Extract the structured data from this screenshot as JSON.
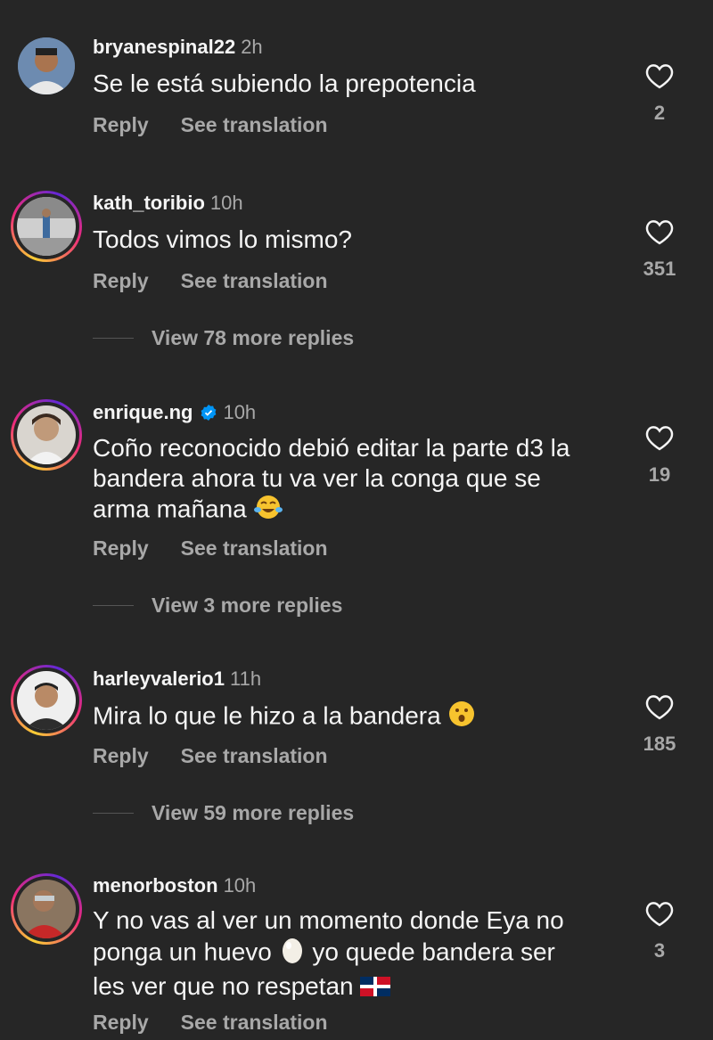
{
  "comments": [
    {
      "username": "bryanespinal22",
      "time": "2h",
      "text": "Se le está subiendo la prepotencia",
      "reply": "Reply",
      "translate": "See translation",
      "likes": "2"
    },
    {
      "username": "kath_toribio",
      "time": "10h",
      "text": "Todos vimos lo mismo?",
      "reply": "Reply",
      "translate": "See translation",
      "likes": "351",
      "more": "View 78 more replies"
    },
    {
      "username": "enrique.ng",
      "time": "10h",
      "text_lines": [
        "Coño reconocido debió editar la parte d3 la",
        "bandera ahora tu va ver la conga que se",
        "arma mañana"
      ],
      "reply": "Reply",
      "translate": "See translation",
      "likes": "19",
      "more": "View 3 more replies",
      "verified": true
    },
    {
      "username": "harleyvalerio1",
      "time": "11h",
      "text": "Mira lo que le hizo a la bandera",
      "reply": "Reply",
      "translate": "See translation",
      "likes": "185",
      "more": "View 59 more replies"
    },
    {
      "username": "menorboston",
      "time": "10h",
      "text_lines": [
        "Y no vas al ver un momento donde Eya no",
        "ponga un huevo",
        "yo quede bandera ser",
        "les ver que no respetan"
      ],
      "reply": "Reply",
      "translate": "See translation",
      "likes": "3"
    }
  ],
  "colors": {
    "background": "#262626",
    "muted": "#a8a8a8",
    "verified": "#0095f6"
  },
  "icons": {
    "like": "heart-outline-icon",
    "verified": "verified-badge-icon",
    "laughing": "tears-of-joy-emoji",
    "surprised": "hushed-face-emoji",
    "egg": "egg-emoji",
    "flag": "dominican-flag-emoji"
  }
}
